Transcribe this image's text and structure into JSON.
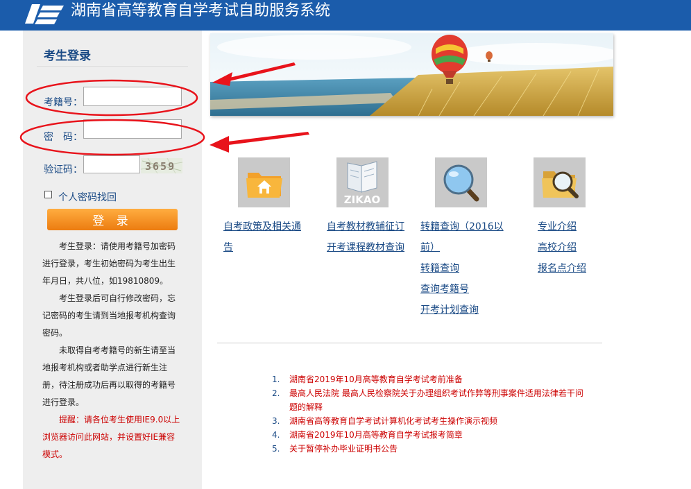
{
  "header": {
    "title": "湖南省高等教育自学考试自助服务系统"
  },
  "login": {
    "title": "考生登录",
    "exam_id_label": "考籍号：",
    "password_label": "密　码：",
    "captcha_label": "验证码：",
    "captcha_text": "3659",
    "find_password": "个人密码找回",
    "submit": "登 录"
  },
  "notes": {
    "p1_a": "考生登录：请使用考籍号加密码",
    "p1_b": "进行登录，考生初始密码为考生出生",
    "p1_c": "年月日，共八位，如19810809。",
    "p2_a": "考生登录后可自行修改密码，忘",
    "p2_b": "记密码的考生请到当地报考机构查询",
    "p2_c": "密码。",
    "p3_a": "未取得自考考籍号的新生请至当",
    "p3_b": "地报考机构或者助学点进行新生注",
    "p3_c": "册，待注册成功后再以取得的考籍号",
    "p3_d": "进行登录。",
    "warn_a": "提醒：请各位考生使用IE9.0以上",
    "warn_b": "浏览器访问此网站，并设置好IE兼容",
    "warn_c": "模式。"
  },
  "tiles": {
    "zikao_text": "ZIKAO"
  },
  "links": {
    "col1_a": "自考政策及相关通",
    "col1_b": "告",
    "col2_a": "自考教材教辅征订",
    "col2_b": "开考课程教材查询",
    "col3_a": "转籍查询（2016以",
    "col3_b": "前）",
    "col3_c": "转籍查询",
    "col3_d": "查询考籍号",
    "col3_e": "开考计划查询",
    "col4_a": "专业介绍",
    "col4_b": "高校介绍",
    "col4_c": "报名点介绍"
  },
  "news": [
    {
      "num": "1.",
      "text": "湖南省2019年10月高等教育自学考试考前准备"
    },
    {
      "num": "2.",
      "text": "最高人民法院 最高人民检察院关于办理组织考试作弊等刑事案件适用法律若干问题的解释"
    },
    {
      "num": "3.",
      "text": "湖南省高等教育自学考试计算机化考试考生操作演示视频"
    },
    {
      "num": "4.",
      "text": "湖南省2019年10月高等教育自学考试报考简章"
    },
    {
      "num": "5.",
      "text": "关于暂停补办毕业证明书公告"
    }
  ],
  "colors": {
    "header_bg": "#1b5cab",
    "link_blue": "#1a4a85",
    "alert_red": "#cc0000",
    "button_orange": "#f39322",
    "annotation_red": "#e8131b"
  }
}
